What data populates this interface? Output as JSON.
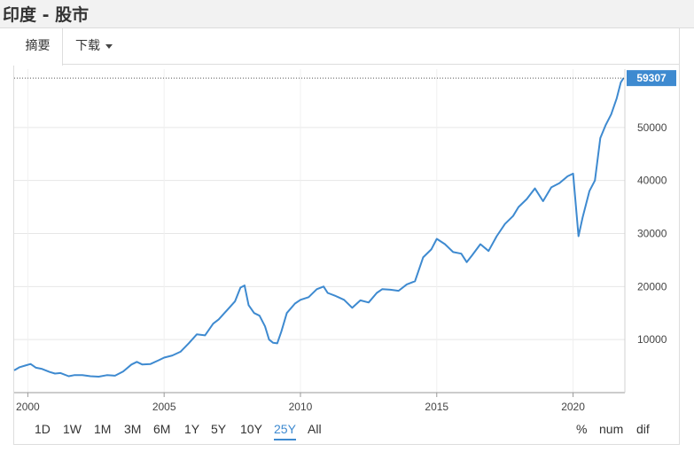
{
  "page": {
    "title": "印度 - 股市"
  },
  "tabs": [
    {
      "label": "摘要",
      "active": true
    },
    {
      "label": "下载",
      "has_dropdown": true,
      "dropdown_icon": "caret-down-icon"
    }
  ],
  "range_buttons": [
    "1D",
    "1W",
    "1M",
    "3M",
    "6M",
    "1Y",
    "5Y",
    "10Y",
    "25Y",
    "All"
  ],
  "active_range": "25Y",
  "mode_buttons": [
    "%",
    "num",
    "dif"
  ],
  "colors": {
    "line": "#3e8ad0",
    "last_value_badge": "#3e8ad0",
    "active_range": "#3e8ad0",
    "grid": "#e6e6e6"
  },
  "chart_data": {
    "type": "line",
    "title": "",
    "xlabel": "",
    "ylabel": "",
    "x_ticks": [
      "2000",
      "2005",
      "2010",
      "2015",
      "2020"
    ],
    "y_ticks": [
      "10000",
      "20000",
      "30000",
      "40000",
      "50000"
    ],
    "ylim": [
      0,
      61000
    ],
    "xlim": [
      1999.5,
      2021.9
    ],
    "grid": true,
    "y_axis_position": "right",
    "last_value_label": "59307",
    "series": [
      {
        "x": [
          1999.5,
          1999.7,
          1999.9,
          2000.1,
          2000.3,
          2000.5,
          2000.8,
          2001.0,
          2001.2,
          2001.5,
          2001.7,
          2002.0,
          2002.3,
          2002.6,
          2002.9,
          2003.2,
          2003.5,
          2003.8,
          2004.0,
          2004.2,
          2004.5,
          2004.8,
          2005.0,
          2005.3,
          2005.6,
          2005.9,
          2006.2,
          2006.5,
          2006.8,
          2007.0,
          2007.3,
          2007.6,
          2007.8,
          2007.95,
          2008.1,
          2008.3,
          2008.5,
          2008.7,
          2008.85,
          2009.0,
          2009.15,
          2009.3,
          2009.5,
          2009.8,
          2010.0,
          2010.3,
          2010.6,
          2010.85,
          2011.0,
          2011.3,
          2011.6,
          2011.9,
          2012.2,
          2012.5,
          2012.8,
          2013.0,
          2013.3,
          2013.6,
          2013.9,
          2014.2,
          2014.5,
          2014.8,
          2015.0,
          2015.3,
          2015.6,
          2015.9,
          2016.1,
          2016.3,
          2016.6,
          2016.9,
          2017.2,
          2017.5,
          2017.8,
          2018.0,
          2018.3,
          2018.6,
          2018.9,
          2019.2,
          2019.5,
          2019.8,
          2020.0,
          2020.2,
          2020.35,
          2020.6,
          2020.8,
          2021.0,
          2021.2,
          2021.4,
          2021.6,
          2021.75,
          2021.85
        ],
        "y": [
          4200,
          4800,
          5100,
          5400,
          4700,
          4500,
          3900,
          3600,
          3700,
          3100,
          3300,
          3300,
          3100,
          3000,
          3300,
          3200,
          4000,
          5300,
          5800,
          5300,
          5400,
          6100,
          6600,
          7000,
          7700,
          9300,
          11000,
          10800,
          13000,
          13800,
          15500,
          17200,
          19800,
          20200,
          16500,
          15000,
          14500,
          12500,
          10000,
          9400,
          9300,
          11500,
          15000,
          16800,
          17500,
          18000,
          19500,
          20000,
          18800,
          18200,
          17500,
          16000,
          17400,
          17000,
          18800,
          19500,
          19400,
          19200,
          20400,
          21000,
          25500,
          27000,
          29000,
          28000,
          26500,
          26200,
          24600,
          25900,
          28000,
          26700,
          29500,
          31800,
          33300,
          35000,
          36500,
          38500,
          36100,
          38700,
          39500,
          40800,
          41300,
          29500,
          33000,
          38000,
          40000,
          48000,
          50500,
          52500,
          55500,
          58500,
          59307
        ]
      }
    ]
  }
}
